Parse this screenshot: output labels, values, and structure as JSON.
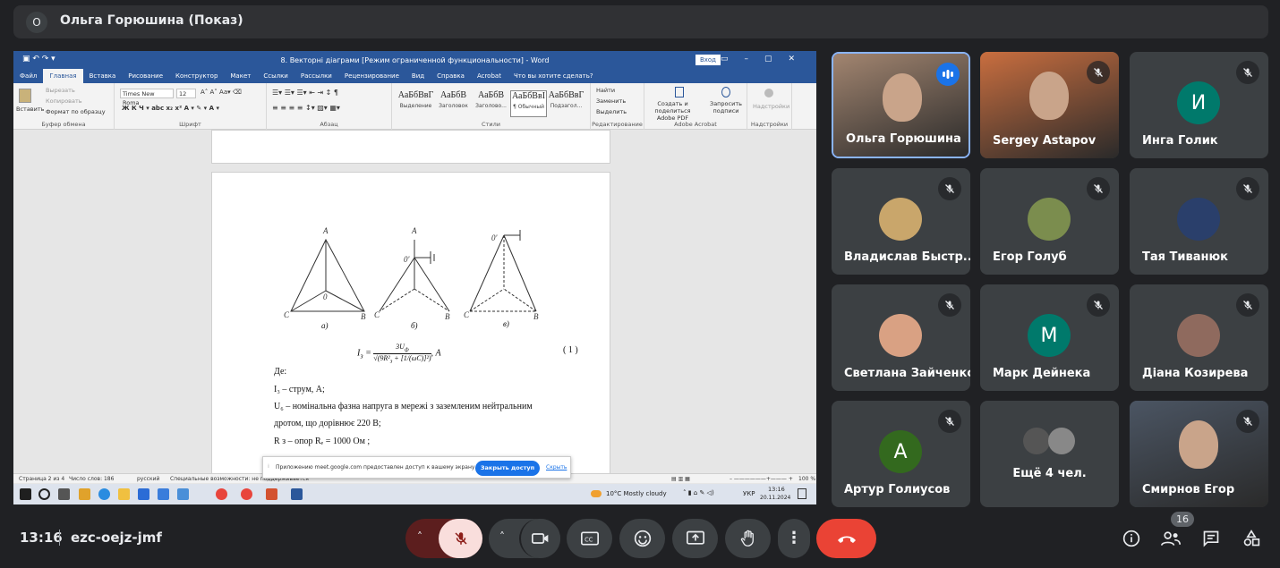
{
  "presenter": {
    "initial": "О",
    "title": "Ольга Горюшина (Показ)"
  },
  "word": {
    "title": "8. Векторні діаграми [Режим ограниченной функциональности] - Word",
    "login": "Вход",
    "tabs": [
      "Файл",
      "Главная",
      "Вставка",
      "Рисование",
      "Конструктор",
      "Макет",
      "Ссылки",
      "Рассылки",
      "Рецензирование",
      "Вид",
      "Справка",
      "Acrobat",
      "Что вы хотите сделать?"
    ],
    "clipboard": {
      "paste": "Вставить",
      "cut": "Вырезать",
      "copy": "Копировать",
      "format": "Формат по образцу",
      "caption": "Буфер обмена"
    },
    "font": {
      "name": "Times New Roma",
      "size": "12",
      "caption": "Шрифт"
    },
    "paragraph": {
      "caption": "Абзац"
    },
    "styles": {
      "items": [
        {
          "sample": "АаБбВвГ",
          "label": "Выделение"
        },
        {
          "sample": "АаБбВ",
          "label": "Заголовок"
        },
        {
          "sample": "АаБбВ",
          "label": "Заголово..."
        },
        {
          "sample": "АаБбВвI",
          "label": "¶ Обычный"
        },
        {
          "sample": "АаБбВвГ",
          "label": "Подзагол..."
        }
      ],
      "caption": "Стили"
    },
    "editing": {
      "find": "Найти",
      "replace": "Заменить",
      "select": "Выделить",
      "caption": "Редактирование"
    },
    "acrobat": {
      "create": "Создать и поделиться Adobe PDF",
      "request": "Запросить подписи",
      "caption": "Adobe Acrobat"
    },
    "addins": {
      "label": "Надстройки",
      "caption": "Надстройки"
    },
    "doc": {
      "diagram_labels": {
        "a": "а)",
        "b": "б)",
        "c": "в)"
      },
      "formula_num": "( 1 )",
      "formula_unit": ", А",
      "lines": [
        "Де:",
        "I₃ – струм, А;",
        "U₆ – номінальна  фазна   напруга в мережі з    заземленим  нейтральним",
        "дротом, що дорівнює 220 В;",
        "R з – опор  Rₑ =  1000 Ом ;"
      ]
    },
    "status": {
      "page": "Страница 2 из 4",
      "words": "Число слов: 186",
      "lang": "русский",
      "access": "Специальные возможности: не поддерживается",
      "zoom": "100 %"
    },
    "notification": {
      "message": "Приложению meet.google.com предоставлен доступ к вашему экрану.",
      "button": "Закрыть доступ",
      "hide": "Скрыть"
    },
    "taskbar": {
      "weather": "10°C  Mostly cloudy",
      "lang": "УКР",
      "time": "13:16",
      "date": "20.11.2024"
    }
  },
  "participants": [
    {
      "name": "Ольга Горюшина",
      "initial": "",
      "color": "#a28570",
      "speaking": true
    },
    {
      "name": "Sergey Astapov",
      "initial": "",
      "color": "#c96e3f",
      "speaking": false
    },
    {
      "name": "Инга Голик",
      "initial": "И",
      "color": "#00796b",
      "speaking": false
    },
    {
      "name": "Владислав Быстр...",
      "initial": "",
      "color": "#c9a66b",
      "speaking": false
    },
    {
      "name": "Егор Голуб",
      "initial": "",
      "color": "#7b8d4e",
      "speaking": false
    },
    {
      "name": "Тая Тиванюк",
      "initial": "",
      "color": "#2a3f6b",
      "speaking": false
    },
    {
      "name": "Светлана Зайченко",
      "initial": "",
      "color": "#d9a183",
      "speaking": false
    },
    {
      "name": "Марк Дейнека",
      "initial": "М",
      "color": "#00796b",
      "speaking": false
    },
    {
      "name": "Діана Козирева",
      "initial": "",
      "color": "#8f6a5e",
      "speaking": false
    },
    {
      "name": "Артур Голиусов",
      "initial": "А",
      "color": "#33691e",
      "speaking": false
    },
    {
      "name": "Ещё 4 чел.",
      "initial": "",
      "color": "#6b6b6b",
      "speaking": false
    },
    {
      "name": "Смирнов Егор",
      "initial": "",
      "color": "#4b5563",
      "speaking": false
    }
  ],
  "meeting": {
    "time": "13:16",
    "code": "ezc-oejz-jmf",
    "participant_count": "16"
  }
}
